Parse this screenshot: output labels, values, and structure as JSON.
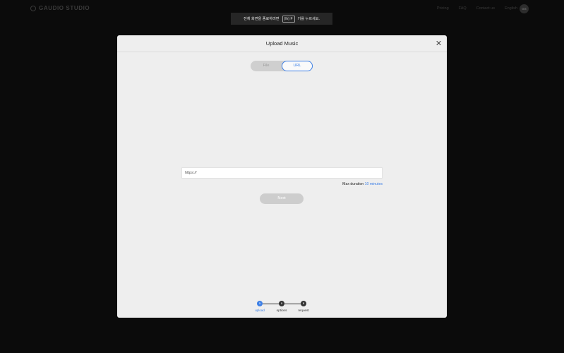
{
  "nav": {
    "logo_text": "GAUDIO STUDIO",
    "links": [
      "Pricing",
      "FAQ",
      "Contact us",
      "English"
    ],
    "avatar_initials": "GS"
  },
  "toast": {
    "text_before": "전체 화면을 종료하려면",
    "key": "(fn) F",
    "text_after": "키를 누르세요."
  },
  "modal": {
    "title": "Upload Music",
    "close_icon": "close-icon",
    "tabs": [
      {
        "label": "File",
        "selected": false
      },
      {
        "label": "URL",
        "selected": true
      }
    ],
    "url_input": {
      "value": "",
      "placeholder": "https://"
    },
    "max_duration_label": "Max duration",
    "max_duration_value": "10 minutes",
    "next_label": "Next",
    "steps": [
      {
        "number": "1",
        "label": "upload",
        "active": true
      },
      {
        "number": "2",
        "label": "options",
        "active": false
      },
      {
        "number": "3",
        "label": "request",
        "active": false
      }
    ]
  },
  "colors": {
    "accent": "#3c7fe6",
    "backdrop": "#0b0b0b",
    "modal_bg": "#eeeeee"
  }
}
